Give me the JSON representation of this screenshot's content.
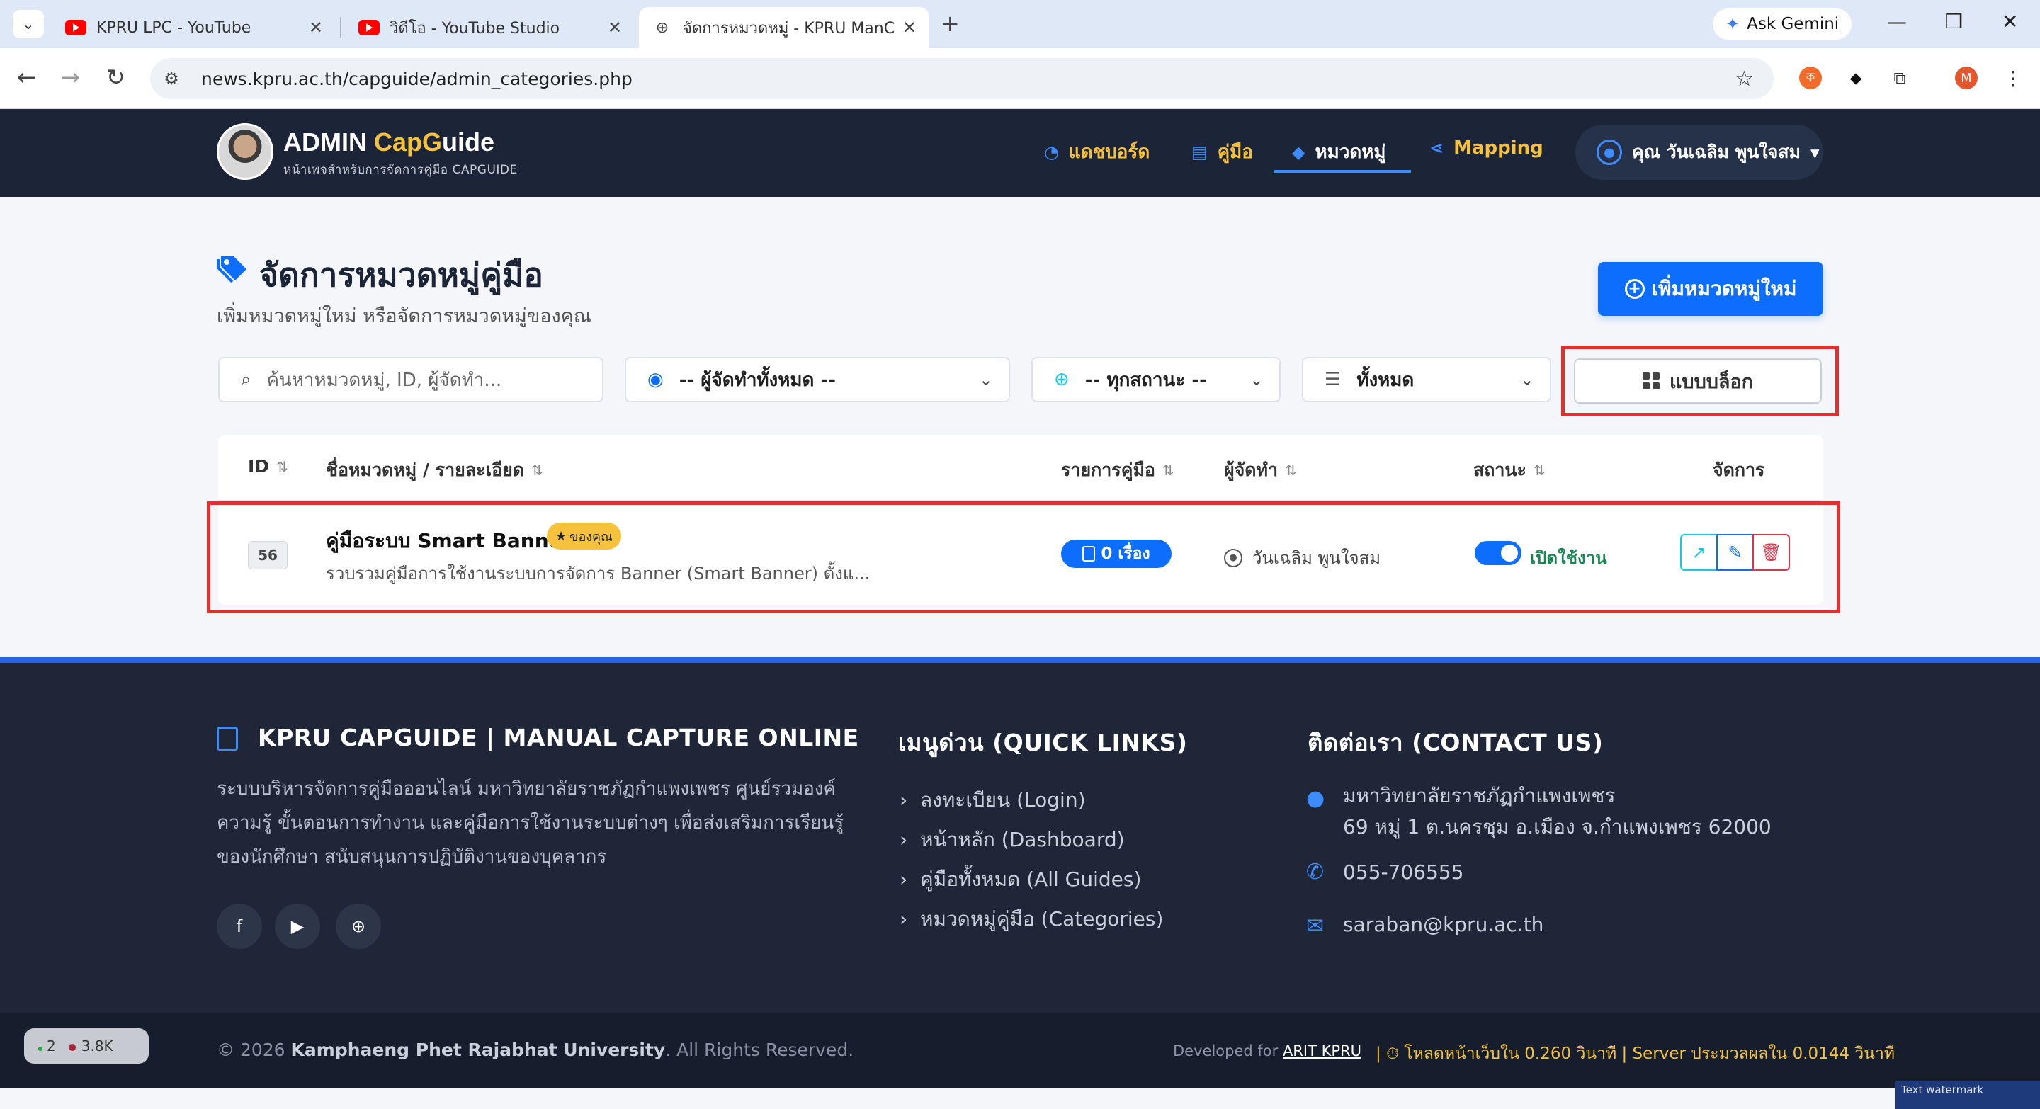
{
  "browser": {
    "tabs": [
      {
        "title": "KPRU LPC - YouTube",
        "icon": "youtube-icon"
      },
      {
        "title": "วิดีโอ - YouTube Studio",
        "icon": "youtube-icon"
      },
      {
        "title": "จัดการหมวดหมู่ - KPRU ManCap",
        "icon": "globe-icon"
      }
    ],
    "gemini_label": "Ask Gemini",
    "url": "news.kpru.ac.th/capguide/admin_categories.php",
    "profile_initial": "M"
  },
  "header": {
    "brand_prefix": "ADMIN ",
    "brand_cap": "Cap",
    "brand_g": "G",
    "brand_rest": "uide",
    "subtitle": "หน้าเพจสำหรับการจัดการคู่มือ CAPGUIDE",
    "nav": [
      {
        "label": "แดชบอร์ด",
        "icon": "dashboard-icon"
      },
      {
        "label": "คู่มือ",
        "icon": "book-icon"
      },
      {
        "label": "หมวดหมู่",
        "icon": "tag-icon",
        "active": true
      },
      {
        "label": "Mapping",
        "icon": "share-icon"
      }
    ],
    "user_label": "คุณ วันเฉลิม พูนใจสม"
  },
  "main": {
    "title": "จัดการหมวดหมู่คู่มือ",
    "subtitle": "เพิ่มหมวดหมู่ใหม่ หรือจัดการหมวดหมู่ของคุณ",
    "add_button": "เพิ่มหมวดหมู่ใหม่",
    "filters": {
      "search_placeholder": "ค้นหาหมวดหมู่, ID, ผู้จัดทำ...",
      "manager_select": "-- ผู้จัดทำทั้งหมด --",
      "status_select": "-- ทุกสถานะ --",
      "type_select": "ทั้งหมด",
      "view_button": "แบบบล็อก"
    },
    "table": {
      "headers": {
        "id": "ID",
        "name": "ชื่อหมวดหมู่ / รายละเอียด",
        "count": "รายการคู่มือ",
        "manager": "ผู้จัดทำ",
        "status": "สถานะ",
        "actions": "จัดการ"
      },
      "rows": [
        {
          "id": "56",
          "name": "คู่มือระบบ Smart Banner",
          "badge": "ของคุณ",
          "description": "รวบรวมคู่มือการใช้งานระบบการจัดการ Banner (Smart Banner) ตั้งแ...",
          "count": "0 เรื่อง",
          "manager": "วันเฉลิม พูนใจสม",
          "status": "เปิดใช้งาน",
          "status_on": true
        }
      ]
    }
  },
  "footer": {
    "about_title": "KPRU CAPGUIDE | MANUAL CAPTURE ONLINE",
    "about_lines": [
      "ระบบบริหารจัดการคู่มือออนไลน์ มหาวิทยาลัยราชภัฏกำแพงเพชร ศูนย์รวมองค์",
      "ความรู้ ขั้นตอนการทำงาน และคู่มือการใช้งานระบบต่างๆ เพื่อส่งเสริมการเรียนรู้",
      "ของนักศึกษา สนับสนุนการปฏิบัติงานของบุคลากร"
    ],
    "quick_title": "เมนูด่วน (QUICK LINKS)",
    "quick_links": [
      "ลงทะเบียน (Login)",
      "หน้าหลัก (Dashboard)",
      "คู่มือทั้งหมด (All Guides)",
      "หมวดหมู่คู่มือ (Categories)"
    ],
    "contact_title": "ติดต่อเรา (CONTACT US)",
    "contact": {
      "address_line1": "มหาวิทยาลัยราชภัฏกำแพงเพชร",
      "address_line2": "69 หมู่ 1 ต.นครชุม อ.เมือง จ.กำแพงเพชร 62000",
      "phone": "055-706555",
      "email": "saraban@kpru.ac.th"
    },
    "copyright_prefix": "© 2026 ",
    "copyright_org": "Kamphaeng Phet Rajabhat University",
    "copyright_suffix": ". All Rights Reserved.",
    "dev_prefix": "Developed for ",
    "dev_org": "ARIT KPRU",
    "load_time": "|  ⏱ โหลดหน้าเว็บใน 0.260 วินาที  |  Server ประมวลผลใน 0.0144 วินาที"
  },
  "overlay": {
    "count_a": "2",
    "count_b": "3.8K",
    "watermark": "Text watermark"
  },
  "colors": {
    "header_bg": "#1b2537",
    "accent_yellow": "#f6c23e",
    "primary": "#0d6efd",
    "highlight": "#e03131",
    "footer_bg": "#1e2638"
  }
}
